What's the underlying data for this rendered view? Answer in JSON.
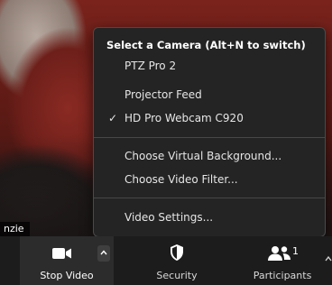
{
  "video": {
    "name_tag": "nzie"
  },
  "camera_menu": {
    "header": "Select a Camera (Alt+N to switch)",
    "cameras": [
      {
        "label": "PTZ Pro 2",
        "selected": false
      },
      {
        "label": "Projector Feed",
        "selected": false
      },
      {
        "label": "HD Pro Webcam C920",
        "selected": true
      }
    ],
    "check_mark": "✓",
    "background_options": [
      {
        "label": "Choose Virtual Background..."
      },
      {
        "label": "Choose Video Filter..."
      }
    ],
    "settings_label": "Video Settings..."
  },
  "toolbar": {
    "stop_video_label": "Stop Video",
    "security_label": "Security",
    "participants_label": "Participants",
    "participants_count": "1"
  }
}
